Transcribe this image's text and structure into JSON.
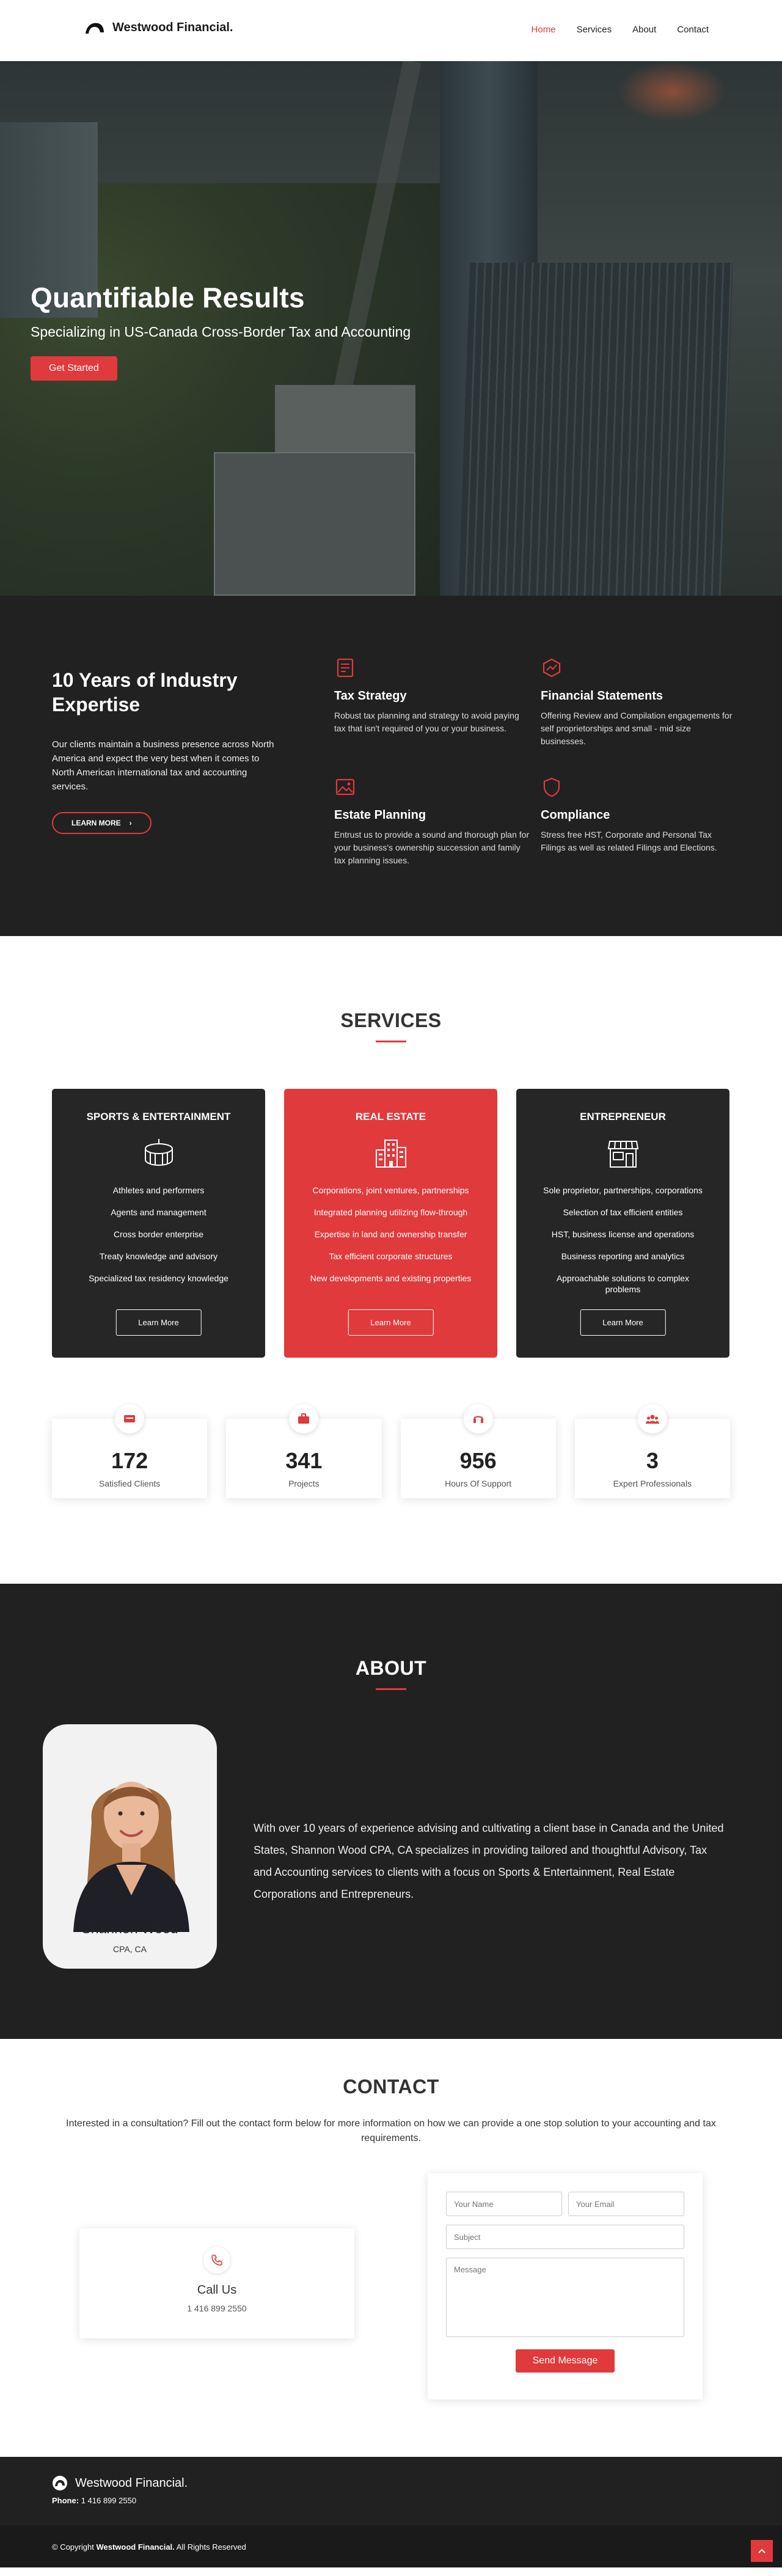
{
  "header": {
    "brand": "Westwood Financial.",
    "nav": [
      "Home",
      "Services",
      "About",
      "Contact"
    ]
  },
  "hero": {
    "title": "Quantifiable Results",
    "subtitle": "Specializing in US-Canada Cross-Border Tax and Accounting",
    "cta": "Get Started"
  },
  "expertise": {
    "title": "10 Years of Industry Expertise",
    "text": "Our clients maintain a business presence across North America and expect the very best when it comes to North American international tax and accounting services.",
    "button": "LEARN MORE",
    "features": [
      {
        "title": "Tax Strategy",
        "text": "Robust tax planning and strategy to avoid paying tax that isn't required of you or your business."
      },
      {
        "title": "Financial Statements",
        "text": "Offering Review and Compilation engagements for self proprietorships and small - mid size businesses."
      },
      {
        "title": "Estate Planning",
        "text": "Entrust us to provide a sound and thorough plan for your business's ownership succession and family tax planning issues."
      },
      {
        "title": "Compliance",
        "text": "Stress free HST, Corporate and Personal Tax Filings as well as related Filings and Elections."
      }
    ]
  },
  "services": {
    "title": "SERVICES",
    "cards": [
      {
        "title": "SPORTS & ENTERTAINMENT",
        "items": [
          "Athletes and performers",
          "Agents and management",
          "Cross border enterprise",
          "Treaty knowledge and advisory",
          "Specialized tax residency knowledge"
        ],
        "button": "Learn More"
      },
      {
        "title": "REAL ESTATE",
        "items": [
          "Corporations, joint ventures, partnerships",
          "Integrated planning utilizing flow-through",
          "Expertise in land and ownership transfer",
          "Tax efficient corporate structures",
          "New developments and existing properties"
        ],
        "button": "Learn More"
      },
      {
        "title": "ENTREPRENEUR",
        "items": [
          "Sole proprietor, partnerships, corporations",
          "Selection of tax efficient entities",
          "HST, business license and operations",
          "Business reporting and analytics",
          "Approachable solutions to complex problems"
        ],
        "button": "Learn More"
      }
    ],
    "stats": [
      {
        "value": "172",
        "label": "Satisfied Clients"
      },
      {
        "value": "341",
        "label": "Projects"
      },
      {
        "value": "956",
        "label": "Hours Of Support"
      },
      {
        "value": "3",
        "label": "Expert Professionals"
      }
    ]
  },
  "about": {
    "title": "ABOUT",
    "name": "Shannon Wood",
    "role": "CPA, CA",
    "text": "With over 10 years of experience advising and cultivating a client base in Canada and the United States, Shannon Wood CPA, CA specializes in providing tailored and thoughtful Advisory, Tax and Accounting services to clients with a focus on Sports & Entertainment, Real Estate Corporations and Entrepreneurs."
  },
  "contact": {
    "title": "CONTACT",
    "intro": "Interested in a consultation? Fill out the contact form below for more information on how we can provide a one stop solution to your accounting and tax requirements.",
    "call_title": "Call Us",
    "call_number": "1 416 899 2550",
    "name_placeholder": "Your Name",
    "email_placeholder": "Your Email",
    "subject_placeholder": "Subject",
    "message_placeholder": "Message",
    "send": "Send Message"
  },
  "footer": {
    "brand": "Westwood Financial.",
    "phone_label": "Phone:",
    "phone": "1 416 899 2550",
    "copy_prefix": "© Copyright",
    "copy_brand": "Westwood Financial.",
    "copy_suffix": "All Rights Reserved"
  },
  "colors": {
    "accent": "#e03a3c",
    "dark": "#212121"
  }
}
